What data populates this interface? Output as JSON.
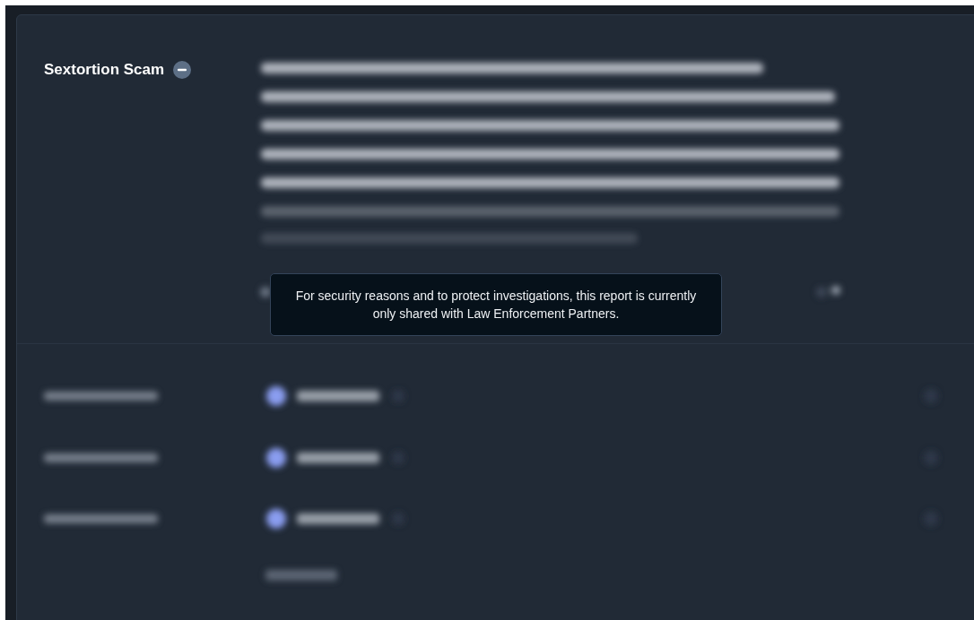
{
  "section": {
    "title": "Sextortion Scam",
    "expanded": true
  },
  "tooltip": {
    "text": "For security reasons and to protect investigations, this report is currently only shared with Law Enforcement Partners."
  }
}
